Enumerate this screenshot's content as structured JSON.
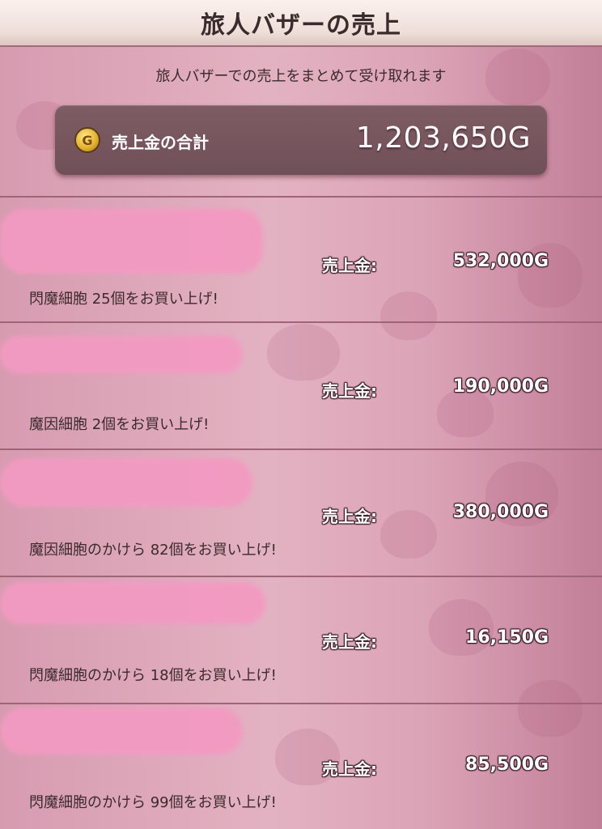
{
  "header": {
    "title": "旅人バザーの売上"
  },
  "subtitle": "旅人バザーでの売上をまとめて受け取れます",
  "total": {
    "icon": "gold-coin-icon",
    "coin_letter": "G",
    "label": "売上金の合計",
    "value": "1,203,650G"
  },
  "sales": [
    {
      "label": "売上金:",
      "value": "532,000G",
      "text": "閃魔細胞  25個をお買い上げ!"
    },
    {
      "label": "売上金:",
      "value": "190,000G",
      "text": "魔因細胞  2個をお買い上げ!"
    },
    {
      "label": "売上金:",
      "value": "380,000G",
      "text": "魔因細胞のかけら  82個をお買い上げ!"
    },
    {
      "label": "売上金:",
      "value": "16,150G",
      "text": "閃魔細胞のかけら  18個をお買い上げ!"
    },
    {
      "label": "売上金:",
      "value": "85,500G",
      "text": "閃魔細胞のかけら  99個をお買い上げ!"
    }
  ],
  "colors": {
    "accent_pink": "#f39ac2",
    "panel_dark": "#705058",
    "row_divider": "#9f6478"
  }
}
